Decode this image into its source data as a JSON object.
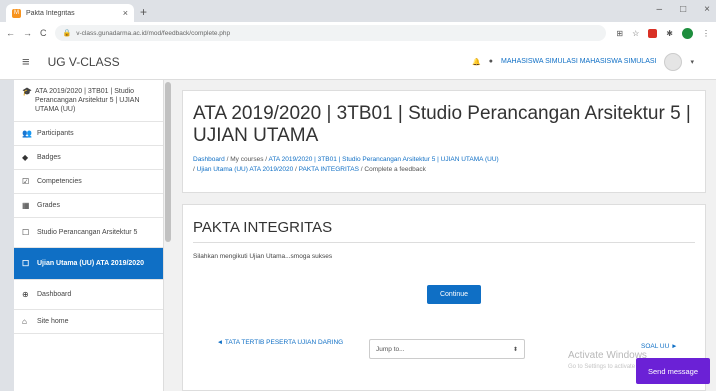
{
  "browser": {
    "tab_title": "Pakta Integritas",
    "url": "v-class.gunadarma.ac.id/mod/feedback/complete.php",
    "new_tab": "+",
    "close_tab": "×",
    "min": "–",
    "max": "□",
    "close": "×",
    "back": "←",
    "forward": "→",
    "reload": "C"
  },
  "navbar": {
    "brand": "UG V-CLASS",
    "user": "MAHASISWA SIMULASI MAHASISWA SIMULASI",
    "user_caret": "▾"
  },
  "drawer": {
    "items": [
      {
        "icon": "graduation-cap-icon",
        "glyph": "🎓",
        "label": "ATA 2019/2020 | 3TB01 | Studio Perancangan Arsitektur 5 | UJIAN UTAMA (UU)"
      },
      {
        "icon": "users-icon",
        "glyph": "👥",
        "label": "Participants"
      },
      {
        "icon": "shield-icon",
        "glyph": "◆",
        "label": "Badges"
      },
      {
        "icon": "check-square-icon",
        "glyph": "☑",
        "label": "Competencies"
      },
      {
        "icon": "table-icon",
        "glyph": "▦",
        "label": "Grades"
      },
      {
        "icon": "folder-icon",
        "glyph": "☐",
        "label": "Studio Perancangan Arsitektur 5"
      },
      {
        "icon": "folder-icon",
        "glyph": "☐",
        "label": "Ujian Utama (UU) ATA 2019/2020"
      },
      {
        "icon": "dashboard-icon",
        "glyph": "⊕",
        "label": "Dashboard"
      },
      {
        "icon": "home-icon",
        "glyph": "⌂",
        "label": "Site home"
      }
    ]
  },
  "header": {
    "title": "ATA 2019/2020 | 3TB01 | Studio Perancangan Arsitektur 5 | UJIAN UTAMA",
    "breadcrumb": {
      "dashboard": "Dashboard",
      "sep": " / ",
      "courses": "My courses",
      "course": "ATA 2019/2020 | 3TB01 | Studio Perancangan Arsitektur 5 | UJIAN UTAMA (UU)",
      "section": "Ujian Utama (UU) ATA 2019/2020",
      "activity": "PAKTA INTEGRITAS",
      "current": "Complete a feedback"
    }
  },
  "card": {
    "title": "PAKTA INTEGRITAS",
    "text": "Silahkan mengikuti Ujian Utama...smoga sukses",
    "continue": "Continue",
    "prev": "◄ TATA TERTIB PESERTA UJIAN DARING",
    "jump_placeholder": "Jump to...",
    "jump_caret": "⬍",
    "next": "SOAL UU ►"
  },
  "overlay": {
    "watermark": "Activate Windows",
    "watermark_sub": "Go to Settings to activate Windows.",
    "send_message": "Send message"
  }
}
